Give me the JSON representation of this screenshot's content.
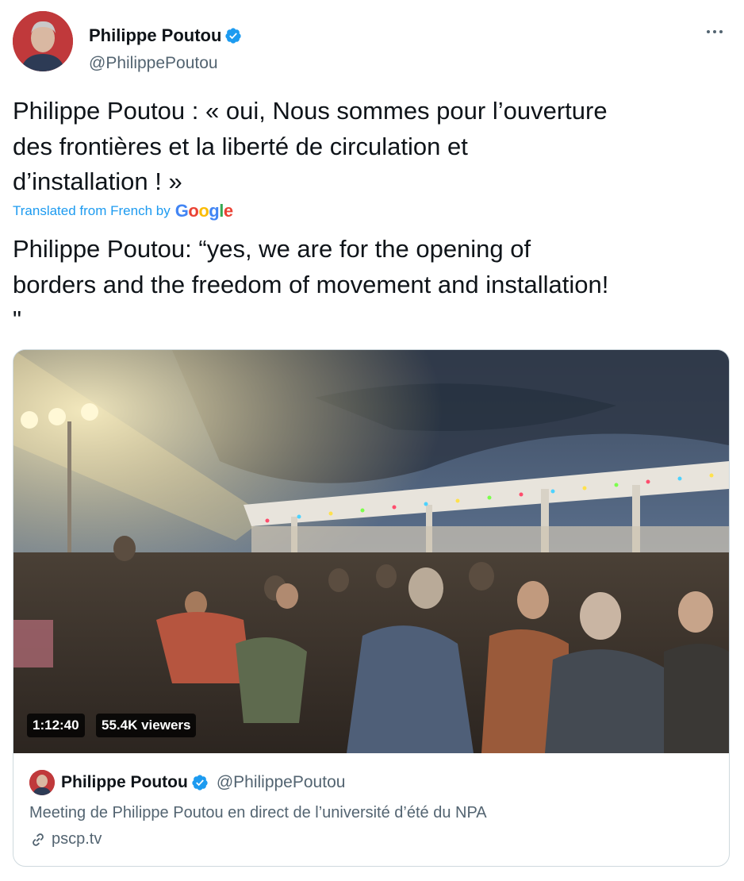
{
  "author": {
    "name": "Philippe Poutou",
    "handle": "@PhilippePoutou"
  },
  "tweet": {
    "text": "Philippe Poutou : « oui, Nous sommes pour l’ouverture\ndes frontières et la liberté de circulation et\nd’installation ! »",
    "translated_label": "Translated from French by",
    "translator": "Google",
    "translation": "Philippe Poutou: “yes, we are for the opening of\nborders and the freedom of movement and installation!\n\""
  },
  "card": {
    "duration": "1:12:40",
    "viewers": "55.4K viewers",
    "author_name": "Philippe Poutou",
    "author_handle": "@PhilippePoutou",
    "description": "Meeting de Philippe Poutou en direct de l’université d’été du NPA",
    "link": "pscp.tv"
  },
  "colors": {
    "accent": "#1d9bf0",
    "text": "#0f1419",
    "secondary": "#536471",
    "border": "#cfd9de"
  },
  "icons": [
    "verified-badge-icon",
    "more-icon",
    "link-icon"
  ]
}
